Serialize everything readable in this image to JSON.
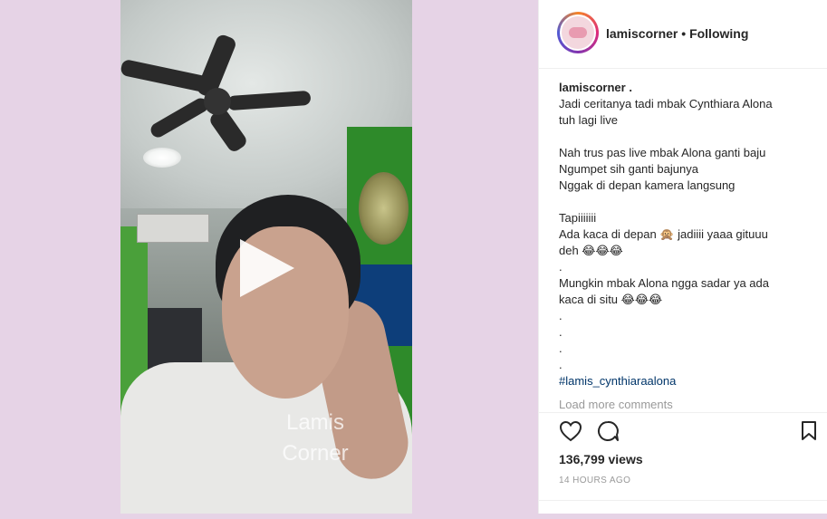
{
  "post": {
    "video": {
      "watermark_line1": "Lamis",
      "watermark_line2": "Corner"
    },
    "header": {
      "username": "lamiscorner",
      "separator": "•",
      "follow_status": "Following"
    },
    "caption": {
      "username": "lamiscorner .",
      "text": "Jadi ceritanya tadi mbak Cynthiara Alona\ntuh lagi live\n\nNah trus pas live mbak Alona ganti baju\nNgumpet sih ganti bajunya\nNggak di depan kamera langsung\n\nTapiiiiiii\nAda kaca di depan 🙊 jadiiii yaaa gituuu\ndeh 😂😂😂\n.\nMungkin mbak Alona ngga sadar ya ada\nkaca di situ 😂😂😂\n.\n.\n.\n.",
      "hashtag": "#lamis_cynthiaraalona"
    },
    "load_more": "Load more comments",
    "stats": {
      "views": "136,799 views",
      "time": "14 HOURS AGO"
    },
    "icons": [
      "heart-icon",
      "comment-icon",
      "save-icon",
      "play-icon"
    ]
  }
}
